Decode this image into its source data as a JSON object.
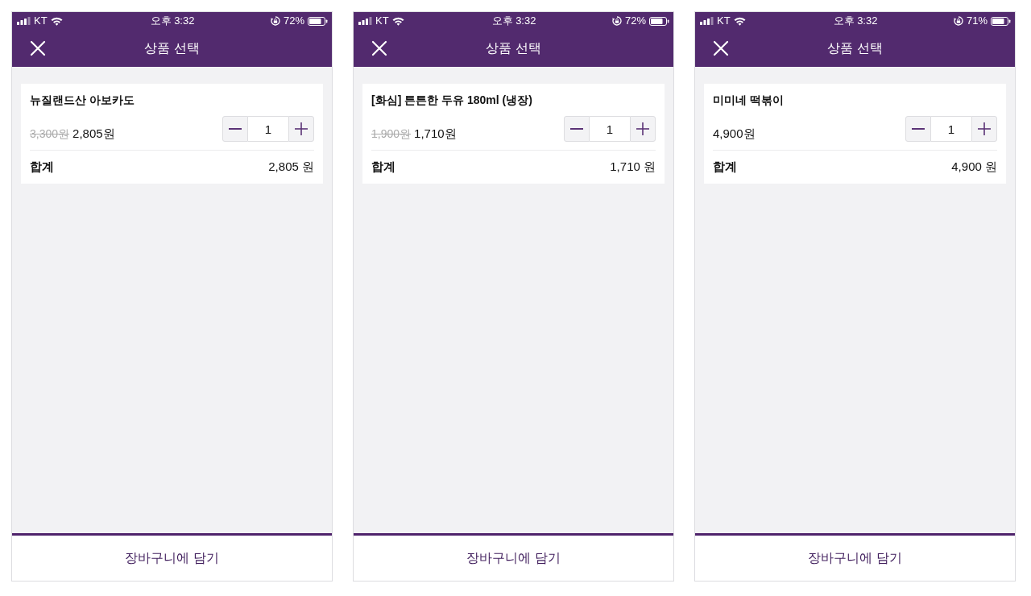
{
  "screens": [
    {
      "status_bar": {
        "carrier": "KT",
        "time": "오후 3:32",
        "battery": "72%"
      },
      "title": "상품 선택",
      "product": {
        "name": "뉴질랜드산 아보카도",
        "original_price": "3,300원",
        "price": "2,805원",
        "quantity": "1"
      },
      "total": {
        "label": "합계",
        "value": "2,805 원"
      },
      "cart_button": "장바구니에 담기"
    },
    {
      "status_bar": {
        "carrier": "KT",
        "time": "오후 3:32",
        "battery": "72%"
      },
      "title": "상품 선택",
      "product": {
        "name": "[화심] 튼튼한 두유 180ml (냉장)",
        "original_price": "1,900원",
        "price": "1,710원",
        "quantity": "1"
      },
      "total": {
        "label": "합계",
        "value": "1,710 원"
      },
      "cart_button": "장바구니에 담기"
    },
    {
      "status_bar": {
        "carrier": "KT",
        "time": "오후 3:32",
        "battery": "71%"
      },
      "title": "상품 선택",
      "product": {
        "name": "미미네 떡볶이",
        "price": "4,900원",
        "quantity": "1"
      },
      "total": {
        "label": "합계",
        "value": "4,900 원"
      },
      "cart_button": "장바구니에 담기"
    }
  ]
}
